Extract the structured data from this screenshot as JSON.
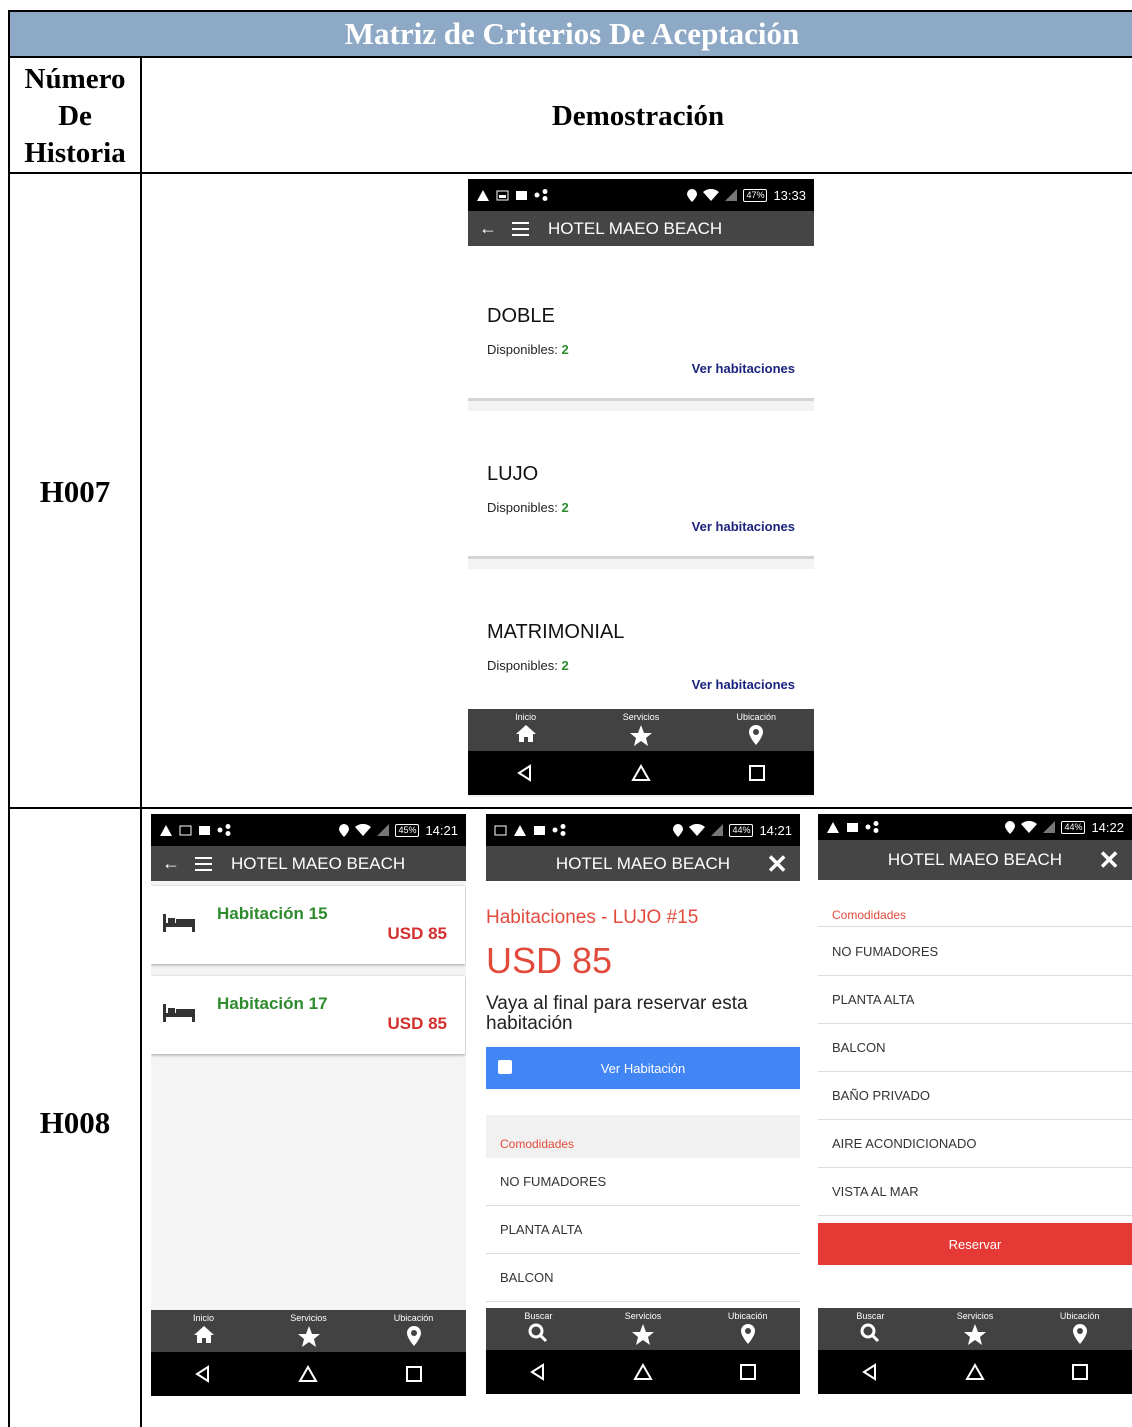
{
  "matrix": {
    "title": "Matriz de Criterios De Aceptación",
    "header_number": "Número De Historia",
    "header_demo": "Demostración",
    "rows": [
      {
        "id": "H007"
      },
      {
        "id": "H008"
      }
    ]
  },
  "phone_h007": {
    "status_time": "13:33",
    "battery": "47%",
    "app_title": "HOTEL MAEO BEACH",
    "rooms": [
      {
        "name": "DOBLE",
        "available_label": "Disponibles:",
        "available_count": "2",
        "link": "Ver habitaciones"
      },
      {
        "name": "LUJO",
        "available_label": "Disponibles:",
        "available_count": "2",
        "link": "Ver habitaciones"
      },
      {
        "name": "MATRIMONIAL",
        "available_label": "Disponibles:",
        "available_count": "2",
        "link": "Ver habitaciones"
      }
    ],
    "nav": [
      "Inicio",
      "Servicios",
      "Ubicación"
    ]
  },
  "phone_list": {
    "status_time": "14:21",
    "battery": "45%",
    "app_title": "HOTEL MAEO BEACH",
    "rooms": [
      {
        "name": "Habitación 15",
        "price": "USD 85"
      },
      {
        "name": "Habitación 17",
        "price": "USD 85"
      }
    ],
    "nav": [
      "Inicio",
      "Servicios",
      "Ubicación"
    ]
  },
  "phone_detail": {
    "status_time": "14:21",
    "battery": "44%",
    "app_title": "HOTEL MAEO BEACH",
    "section_title": "Habitaciones - LUJO #15",
    "price": "USD 85",
    "note": "Vaya al final para reservar esta habitación",
    "view_button": "Ver Habitación",
    "amenities_title": "Comodidades",
    "amenities": [
      "NO FUMADORES",
      "PLANTA ALTA",
      "BALCON"
    ],
    "nav": [
      "Buscar",
      "Servicios",
      "Ubicación"
    ]
  },
  "phone_amenities": {
    "status_time": "14:22",
    "battery": "44%",
    "app_title": "HOTEL MAEO BEACH",
    "amenities_title": "Comodidades",
    "amenities": [
      "NO FUMADORES",
      "PLANTA ALTA",
      "BALCON",
      "BAÑO PRIVADO",
      "AIRE ACONDICIONADO",
      "VISTA AL MAR"
    ],
    "reserve_button": "Reservar",
    "nav": [
      "Buscar",
      "Servicios",
      "Ubicación"
    ]
  },
  "colors": {
    "header_bg": "#8ea9c6",
    "appbar": "#454545",
    "green": "#2e8b2e",
    "red": "#e24b3b",
    "blue_button": "#4285f4",
    "red_button": "#e53935",
    "link": "#1a237e"
  }
}
